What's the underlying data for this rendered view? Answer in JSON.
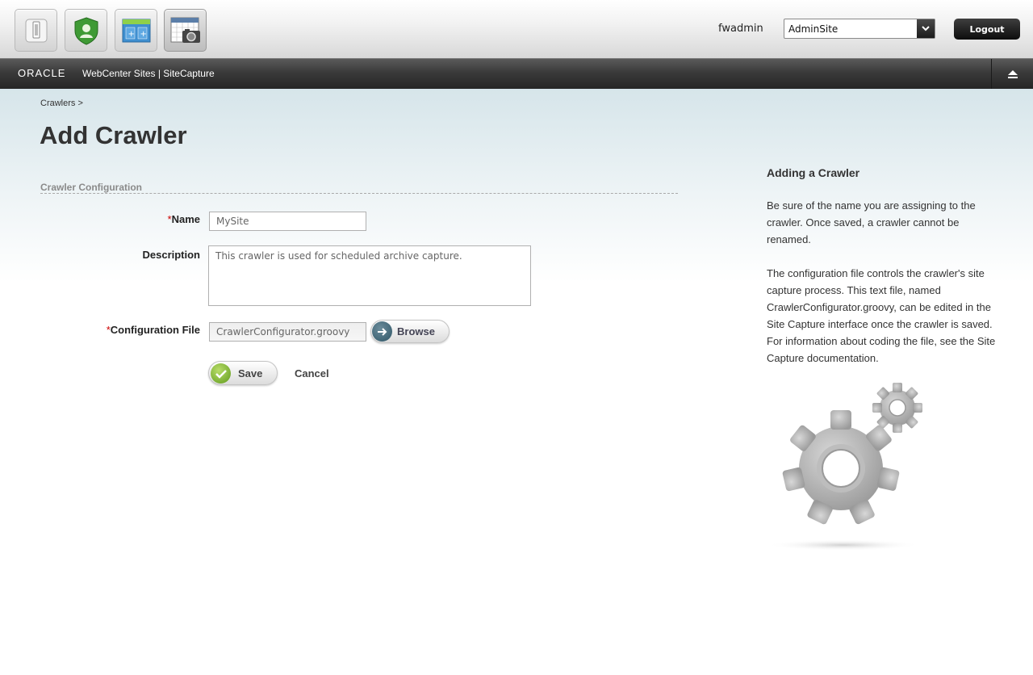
{
  "toolbar": {
    "apps": [
      {
        "name": "contributor-app-icon"
      },
      {
        "name": "admin-app-icon"
      },
      {
        "name": "design-app-icon"
      },
      {
        "name": "sitecapture-app-icon"
      }
    ],
    "username": "fwadmin",
    "site_select": {
      "value": "AdminSite"
    },
    "logout_label": "Logout"
  },
  "brand": {
    "oracle": "ORACLE",
    "product": "WebCenter Sites | SiteCapture"
  },
  "breadcrumb": "Crawlers >",
  "page_title": "Add Crawler",
  "form": {
    "section_title": "Crawler Configuration",
    "required_marker": "*",
    "name": {
      "label": "Name",
      "value": "MySite"
    },
    "description": {
      "label": "Description",
      "value": "This crawler is used for scheduled archive capture."
    },
    "config_file": {
      "label": "Configuration File",
      "value": "CrawlerConfigurator.groovy"
    },
    "browse_label": "Browse",
    "save_label": "Save",
    "cancel_label": "Cancel"
  },
  "help": {
    "title": "Adding a Crawler",
    "paragraph1": "Be sure of the name you are assigning to the crawler. Once saved, a crawler cannot be renamed.",
    "paragraph2": "The configuration file controls the crawler's site capture process. This text file, named CrawlerConfigurator.groovy, can be edited in the Site Capture interface once the crawler is saved. For information about coding the file, see the Site Capture documentation."
  },
  "colors": {
    "required": "#cc0000",
    "brand_bar": "#2e2e2e",
    "content_gradient_top": "#d6e5ea"
  }
}
